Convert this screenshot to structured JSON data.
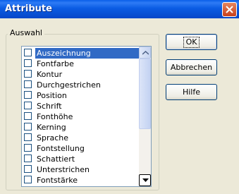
{
  "window": {
    "title": "Attribute"
  },
  "group": {
    "label": "Auswahl"
  },
  "list": {
    "items": [
      {
        "label": "Auszeichnung",
        "checked": false,
        "selected": true
      },
      {
        "label": "Fontfarbe",
        "checked": false
      },
      {
        "label": "Kontur",
        "checked": false
      },
      {
        "label": "Durchgestrichen",
        "checked": false
      },
      {
        "label": "Position",
        "checked": false
      },
      {
        "label": "Schrift",
        "checked": false
      },
      {
        "label": "Fonthöhe",
        "checked": false
      },
      {
        "label": "Kerning",
        "checked": false
      },
      {
        "label": "Sprache",
        "checked": false
      },
      {
        "label": "Fontstellung",
        "checked": false
      },
      {
        "label": "Schattiert",
        "checked": false
      },
      {
        "label": "Unterstrichen",
        "checked": false
      },
      {
        "label": "Fontstärke",
        "checked": false
      }
    ]
  },
  "buttons": {
    "ok": "OK",
    "cancel": "Abbrechen",
    "help": "Hilfe"
  },
  "colors": {
    "titlebar": "#0A5FE8",
    "selection": "#316AC5",
    "close": "#D2552F"
  }
}
